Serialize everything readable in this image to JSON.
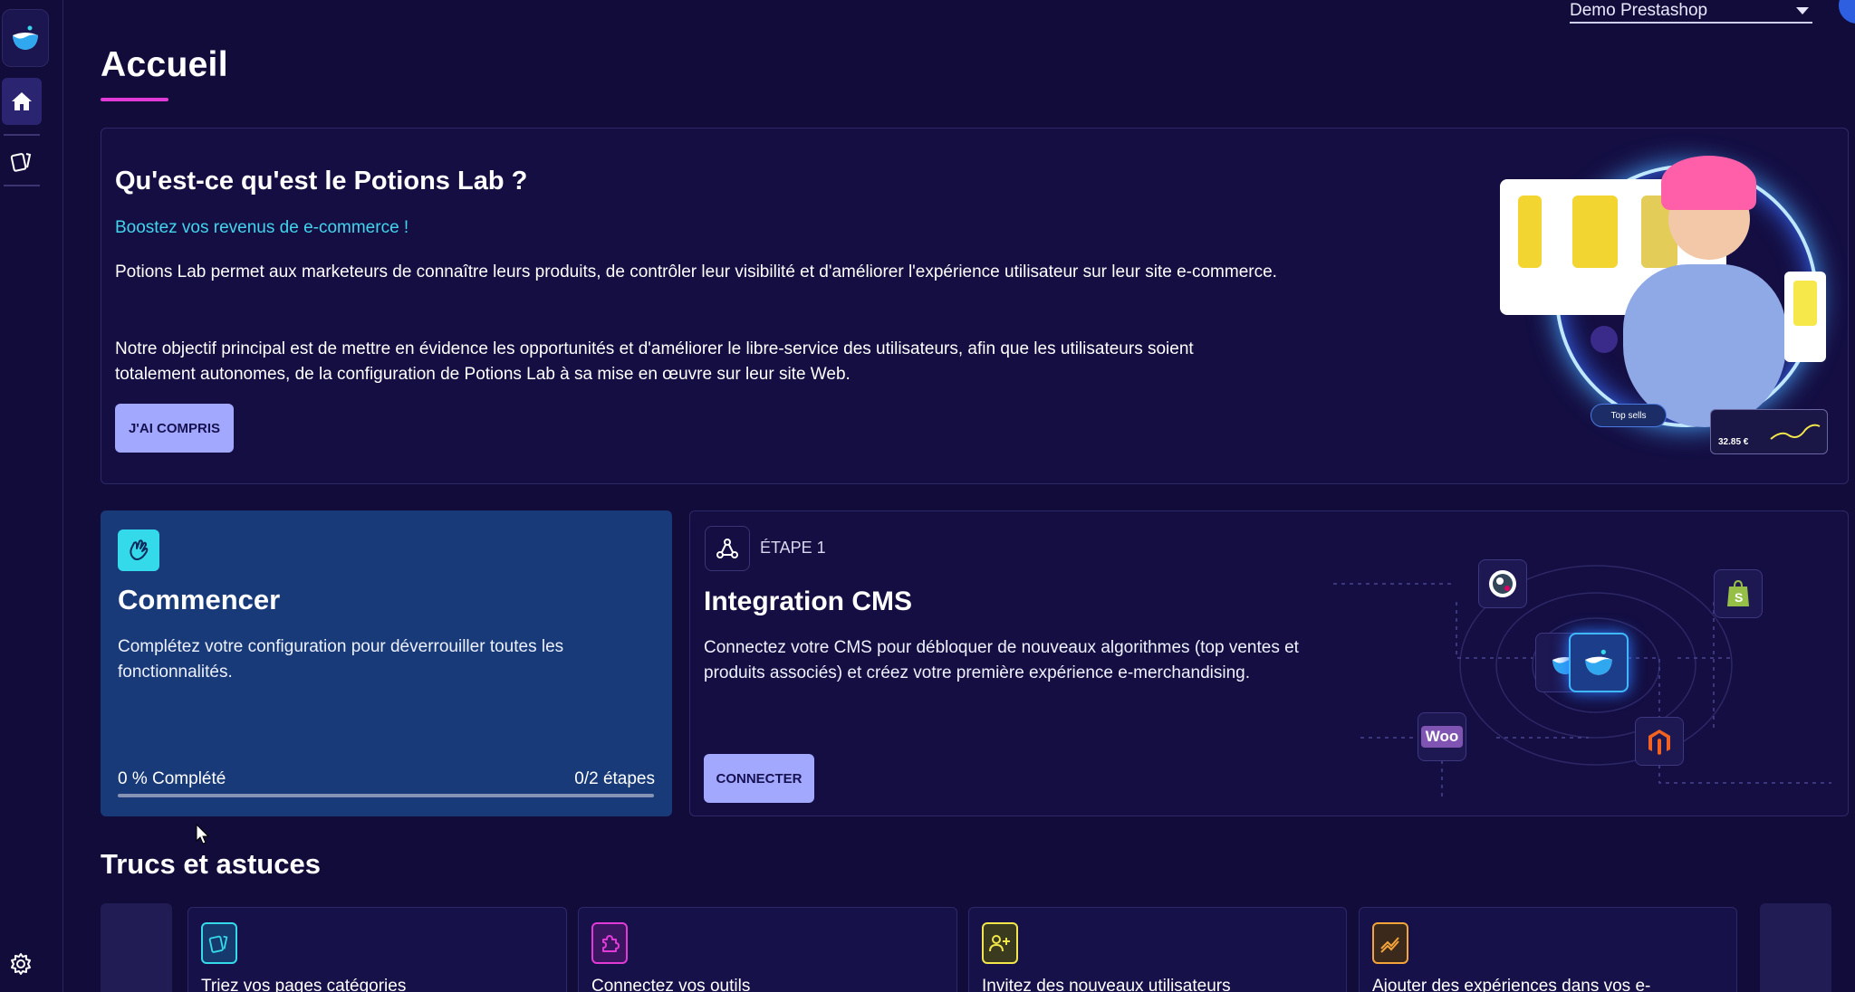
{
  "store_selector": {
    "value": "Demo Prestashop"
  },
  "page": {
    "title": "Accueil"
  },
  "intro": {
    "title": "Qu'est-ce qu'est le Potions Lab ?",
    "subtitle": "Boostez vos revenus de e-commerce !",
    "paragraph_1": "Potions Lab permet aux marketeurs de connaître leurs produits, de contrôler leur visibilité et d'améliorer l'expérience utilisateur sur leur site e-commerce.",
    "paragraph_2": "Notre objectif principal est de mettre en évidence les opportunités et d'améliorer le libre-service des utilisateurs, afin que les utilisateurs soient totalement autonomes, de la configuration de Potions Lab à sa mise en œuvre sur leur site Web.",
    "button": "J'AI COMPRIS",
    "illustration": {
      "pill_label": "Top sells",
      "card_value": "32.85 €"
    }
  },
  "start_card": {
    "title": "Commencer",
    "description": "Complétez votre configuration pour déverrouiller toutes les fonctionnalités.",
    "progress_label": "0 % Complété",
    "progress_steps": "0/2 étapes",
    "progress_fraction": 0
  },
  "cms_card": {
    "step": "ÉTAPE 1",
    "title": "Integration CMS",
    "description": "Connectez votre CMS pour débloquer de nouveaux algorithmes (top ventes et produits associés) et créez votre première expérience e-merchandising.",
    "button": "CONNECTER",
    "woo_label": "Woo"
  },
  "tips": {
    "title": "Trucs et astuces",
    "items": [
      {
        "label": "Triez vos pages catégories",
        "icon": "cards-icon",
        "color": "#34d9ea"
      },
      {
        "label": "Connectez vos outils",
        "icon": "puzzle-icon",
        "color": "#e23ad6"
      },
      {
        "label": "Invitez des nouveaux utilisateurs",
        "icon": "add-user-icon",
        "color": "#f2e64a"
      },
      {
        "label": "Ajouter des expériences dans vos e-",
        "icon": "trend-icon",
        "color": "#f5a43a"
      }
    ]
  },
  "colors": {
    "background": "#120c3a",
    "accent_cyan": "#34d9ea",
    "accent_pink": "#e23ad6",
    "button": "#a3a8ff",
    "start_card": "#183a78"
  }
}
